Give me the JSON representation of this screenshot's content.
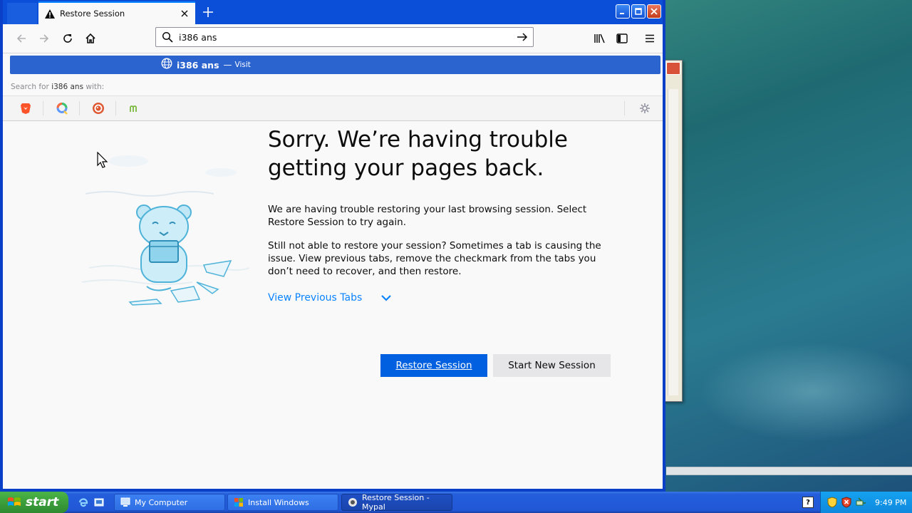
{
  "window": {
    "tab_title": "Restore Session",
    "colors": {
      "titlebar": "#0b4fd8",
      "accent": "#0060df",
      "link": "#0a84ff"
    }
  },
  "navbar": {
    "back_icon": "arrow-left-icon",
    "forward_icon": "arrow-right-icon",
    "reload_icon": "reload-icon",
    "home_icon": "home-icon",
    "url_value": "i386 ans",
    "library_icon": "library-icon",
    "sidebar_icon": "sidebar-icon",
    "menu_icon": "hamburger-menu-icon"
  },
  "suggestion": {
    "text": "i386 ans",
    "dash": "—",
    "action": "Visit"
  },
  "search_with": {
    "prefix": "Search for",
    "term": "i386 ans",
    "suffix": "with:",
    "engines": [
      "brave-icon",
      "qwant-icon",
      "duckduckgo-icon",
      "mojeek-icon"
    ]
  },
  "content": {
    "heading": "Sorry. We’re having trouble getting your pages back.",
    "paragraph1": "We are having trouble restoring your last browsing session. Select Restore Session to try again.",
    "paragraph2": "Still not able to restore your session? Sometimes a tab is causing the issue. View previous tabs, remove the checkmark from the tabs you don’t need to recover, and then restore.",
    "view_previous": "View Previous Tabs",
    "restore_button": "Restore Session",
    "new_session_button": "Start New Session"
  },
  "taskbar": {
    "start_label": "start",
    "tasks": [
      "My Computer",
      "Install Windows",
      "Restore Session - Mypal"
    ],
    "help_label": "?",
    "clock": "9:49 PM"
  }
}
